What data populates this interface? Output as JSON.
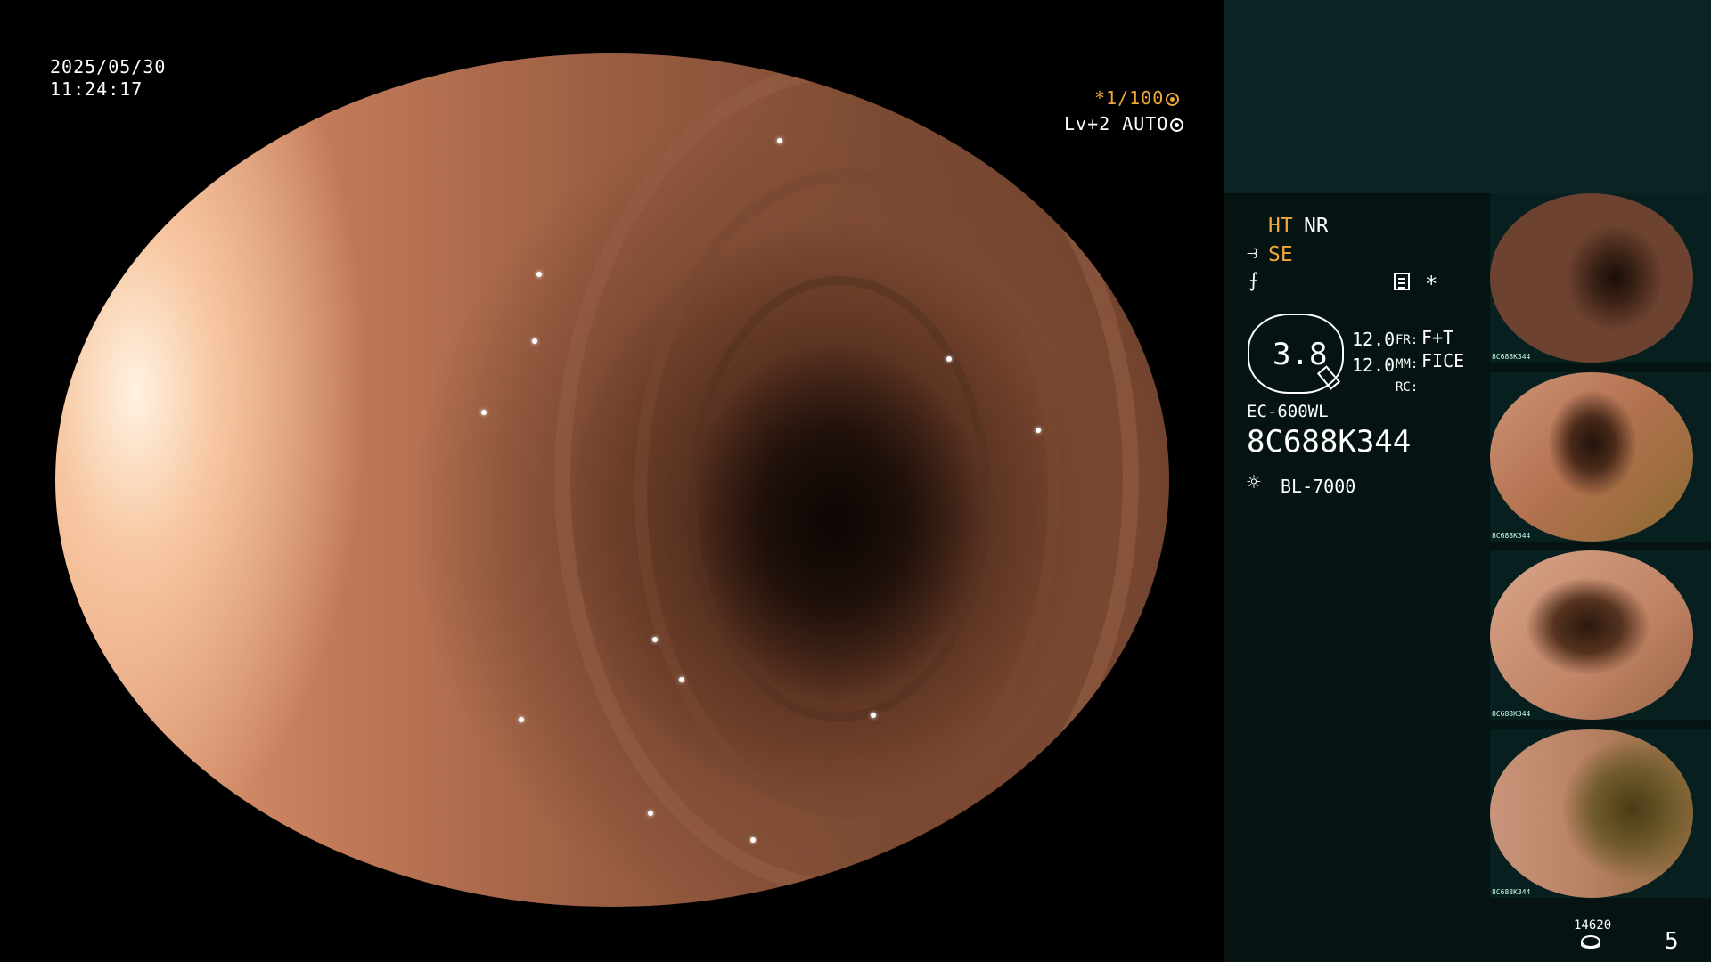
{
  "main_view": {
    "date": "2025/05/30",
    "time": "11:24:17",
    "shutter": "*1/100",
    "level": "Lv+2 AUTO"
  },
  "panel": {
    "ht": "HT",
    "nr": "NR",
    "se": "SE",
    "star": "*",
    "zoom_value": "3.8",
    "value_1": "12.0",
    "value_2": "12.0",
    "fr_key": "FR:",
    "fr_value": "F+T",
    "mm_key": "MM:",
    "mm_value": "FICE",
    "rc_key": "RC:",
    "scope_model": "EC-600WL",
    "scope_serial": "8C688K344",
    "light_source": "BL-7000"
  },
  "thumbnails": [
    {
      "caption": "8C688K344"
    },
    {
      "caption": "8C688K344"
    },
    {
      "caption": "8C688K344"
    },
    {
      "caption": "8C688K344"
    }
  ],
  "footer": {
    "counter": "14620",
    "page_number": "5"
  },
  "colors": {
    "accent_orange": "#f0a838",
    "panel_bg": "#051313",
    "panel_top_bg": "#0b2525"
  }
}
